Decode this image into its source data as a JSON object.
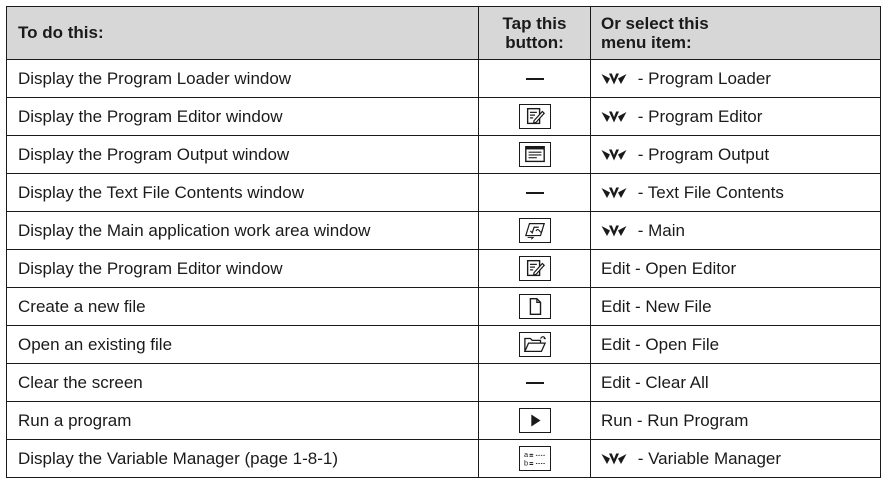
{
  "header": {
    "col1": "To do this:",
    "col2_line1": "Tap this",
    "col2_line2": "button:",
    "col3_line1": "Or select this",
    "col3_line2": "menu item:"
  },
  "rows": [
    {
      "action": "Display the Program Loader window",
      "button_icon": "none",
      "menu_prefix_icon": "main-menu-icon",
      "menu_item": " - Program Loader"
    },
    {
      "action": "Display the Program Editor window",
      "button_icon": "program-editor-icon",
      "menu_prefix_icon": "main-menu-icon",
      "menu_item": " - Program Editor"
    },
    {
      "action": "Display the Program Output window",
      "button_icon": "program-output-icon",
      "menu_prefix_icon": "main-menu-icon",
      "menu_item": " - Program Output"
    },
    {
      "action": "Display the Text File Contents window",
      "button_icon": "none",
      "menu_prefix_icon": "main-menu-icon",
      "menu_item": " - Text File Contents"
    },
    {
      "action": "Display the Main application work area window",
      "button_icon": "main-application-icon",
      "menu_prefix_icon": "main-menu-icon",
      "menu_item": " - Main"
    },
    {
      "action": "Display the Program Editor window",
      "button_icon": "program-editor-icon",
      "menu_prefix_icon": "none",
      "menu_item": "Edit - Open Editor"
    },
    {
      "action": "Create a new file",
      "button_icon": "new-file-icon",
      "menu_prefix_icon": "none",
      "menu_item": "Edit - New File"
    },
    {
      "action": "Open an existing file",
      "button_icon": "open-file-icon",
      "menu_prefix_icon": "none",
      "menu_item": "Edit - Open File"
    },
    {
      "action": "Clear the screen",
      "button_icon": "none",
      "menu_prefix_icon": "none",
      "menu_item": "Edit - Clear All"
    },
    {
      "action": "Run a program",
      "button_icon": "run-program-icon",
      "menu_prefix_icon": "none",
      "menu_item": "Run - Run Program"
    },
    {
      "action": "Display the Variable Manager (page 1-8-1)",
      "button_icon": "variable-manager-icon",
      "menu_prefix_icon": "main-menu-icon",
      "menu_item": " - Variable Manager"
    }
  ]
}
